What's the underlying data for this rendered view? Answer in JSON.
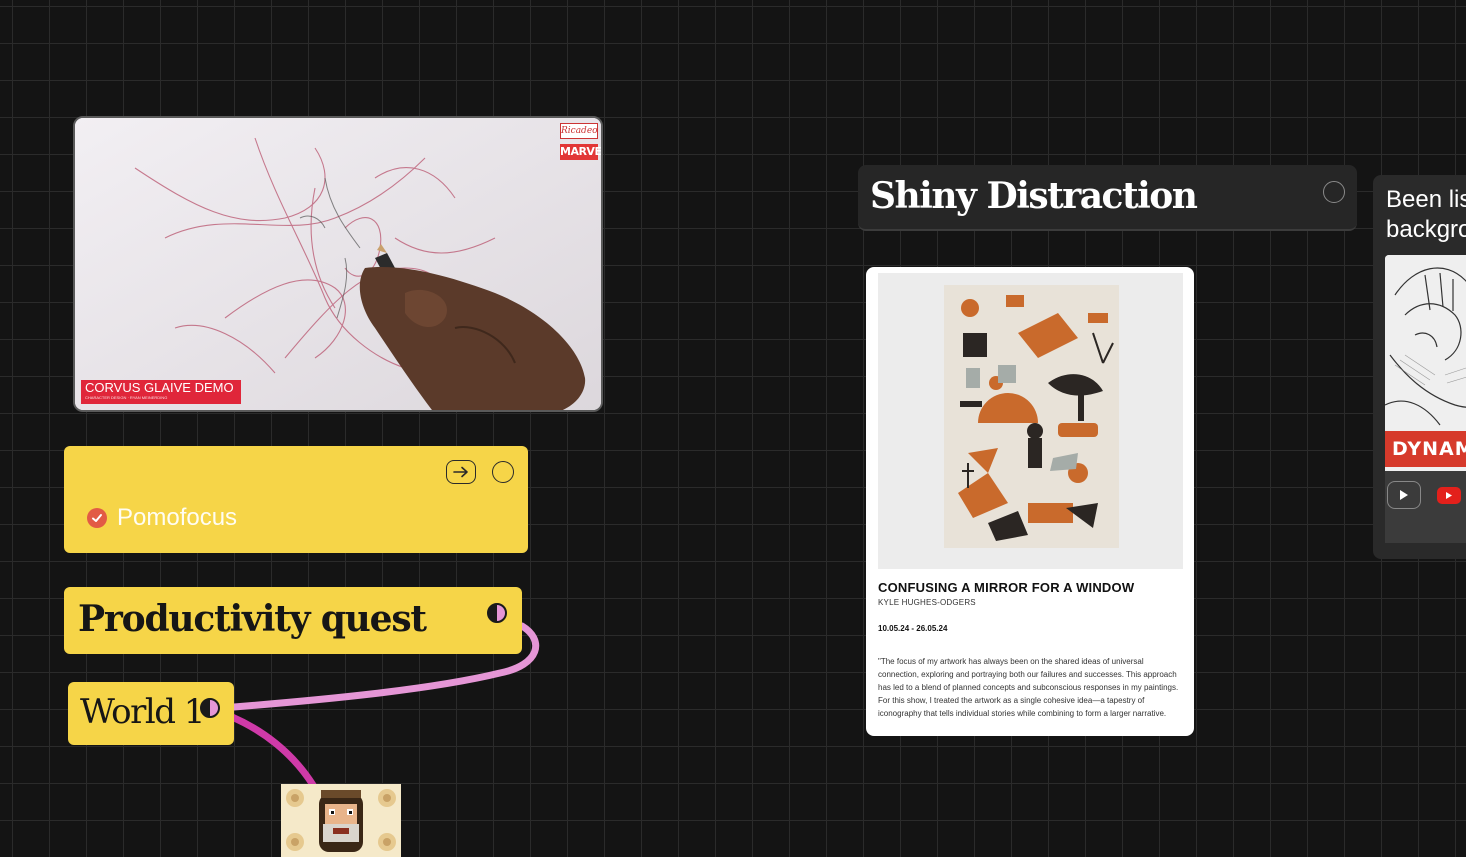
{
  "video_card": {
    "lower_third_title": "CORVUS GLAIVE DEMO",
    "lower_third_subtitle": "CHARACTER DESIGN · RYAN MEINERDING",
    "badge_top": "Ricadeo",
    "badge_brand": "MARVEL"
  },
  "pomofocus_card": {
    "label": "Pomofocus",
    "open_icon": "arrow-right-box-icon",
    "status_icon": "circle-icon"
  },
  "quest_card": {
    "title": "Productivity quest",
    "icon": "half-moon-icon"
  },
  "world_card": {
    "title": "World 1",
    "icon": "half-moon-icon"
  },
  "shiny_card": {
    "title": "Shiny Distraction",
    "status_icon": "circle-icon"
  },
  "exhibit_card": {
    "title": "CONFUSING A MIRROR FOR A WINDOW",
    "artist": "KYLE HUGHES-ODGERS",
    "dates": "10.05.24 - 26.05.24",
    "body": "\"The focus of my artwork has always been on the shared ideas of universal connection, exploring and portraying both our failures and successes. This approach has led to a blend of planned concepts and subconscious responses in my paintings. For this show, I treated the artwork as a single cohesive idea—a tapestry of iconography that tells individual stories while combining to form a larger narrative."
  },
  "been_card": {
    "text": "Been lis\nbackgro",
    "banner": "DYNAM",
    "play_icon": "play-icon",
    "youtube_icon": "youtube-icon"
  },
  "colors": {
    "canvas": "#141414",
    "grid": "#2b2b2b",
    "card_yellow": "#f6d548",
    "card_dark": "#262626",
    "connector_pink": "#e596d6",
    "connector_magenta": "#cf3aa8",
    "pomo_red": "#e25b45"
  }
}
